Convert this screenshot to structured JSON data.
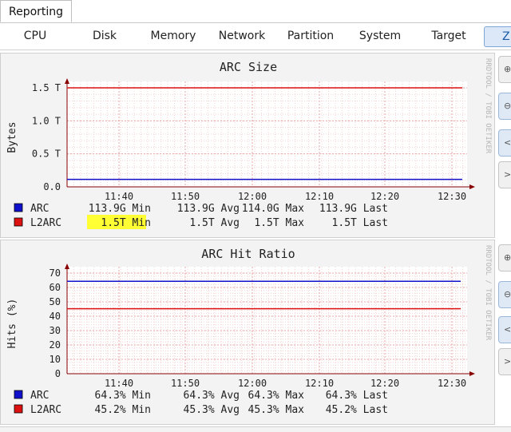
{
  "top_tab": {
    "label": "Reporting"
  },
  "subtabs": [
    "CPU",
    "Disk",
    "Memory",
    "Network",
    "Partition",
    "System",
    "Target",
    "Z"
  ],
  "side_text": "RRDTOOL / TOBI OETIKER",
  "colors": {
    "arc": "#1010cc",
    "l2arc": "#dd1111",
    "highlight": "#ffff33",
    "grid": "#e7aaaa",
    "axis": "#880000"
  },
  "graphs": [
    {
      "title": "ARC Size",
      "ylabel": "Bytes",
      "yticks": [
        "1.5 T",
        "1.0 T",
        "0.5 T",
        "0.0"
      ],
      "xticks": [
        "11:40",
        "11:50",
        "12:00",
        "12:10",
        "12:20",
        "12:30"
      ],
      "legend": [
        {
          "name": "ARC",
          "min": "113.9G Min",
          "avg": "113.9G Avg",
          "max": "114.0G Max",
          "last": "113.9G Last"
        },
        {
          "name": "L2ARC",
          "min": "1.5T Min",
          "avg": "1.5T Avg",
          "max": "1.5T Max",
          "last": "1.5T Last"
        }
      ],
      "chart_data": {
        "type": "line",
        "title": "ARC Size",
        "ylabel": "Bytes",
        "xlabel": "",
        "x_ticks": [
          "11:40",
          "11:50",
          "12:00",
          "12:10",
          "12:20",
          "12:30"
        ],
        "ylim": [
          0,
          1.5
        ],
        "series": [
          {
            "name": "ARC",
            "values": [
              0.114,
              0.114
            ]
          },
          {
            "name": "L2ARC",
            "values": [
              1.5,
              1.5
            ]
          }
        ],
        "grid": true
      }
    },
    {
      "title": "ARC Hit Ratio",
      "ylabel": "Hits (%)",
      "yticks": [
        "70",
        "60",
        "50",
        "40",
        "30",
        "20",
        "10",
        "0"
      ],
      "xticks": [
        "11:40",
        "11:50",
        "12:00",
        "12:10",
        "12:20",
        "12:30"
      ],
      "legend": [
        {
          "name": "ARC",
          "min": "64.3% Min",
          "avg": "64.3% Avg",
          "max": "64.3% Max",
          "last": "64.3% Last"
        },
        {
          "name": "L2ARC",
          "min": "45.2% Min",
          "avg": "45.3% Avg",
          "max": "45.3% Max",
          "last": "45.2% Last"
        }
      ],
      "chart_data": {
        "type": "line",
        "title": "ARC Hit Ratio",
        "ylabel": "Hits (%)",
        "xlabel": "",
        "x_ticks": [
          "11:40",
          "11:50",
          "12:00",
          "12:10",
          "12:20",
          "12:30"
        ],
        "ylim": [
          0,
          70
        ],
        "series": [
          {
            "name": "ARC",
            "values": [
              64.3,
              64.3
            ]
          },
          {
            "name": "L2ARC",
            "values": [
              45.2,
              45.2
            ]
          }
        ],
        "grid": true
      }
    }
  ]
}
